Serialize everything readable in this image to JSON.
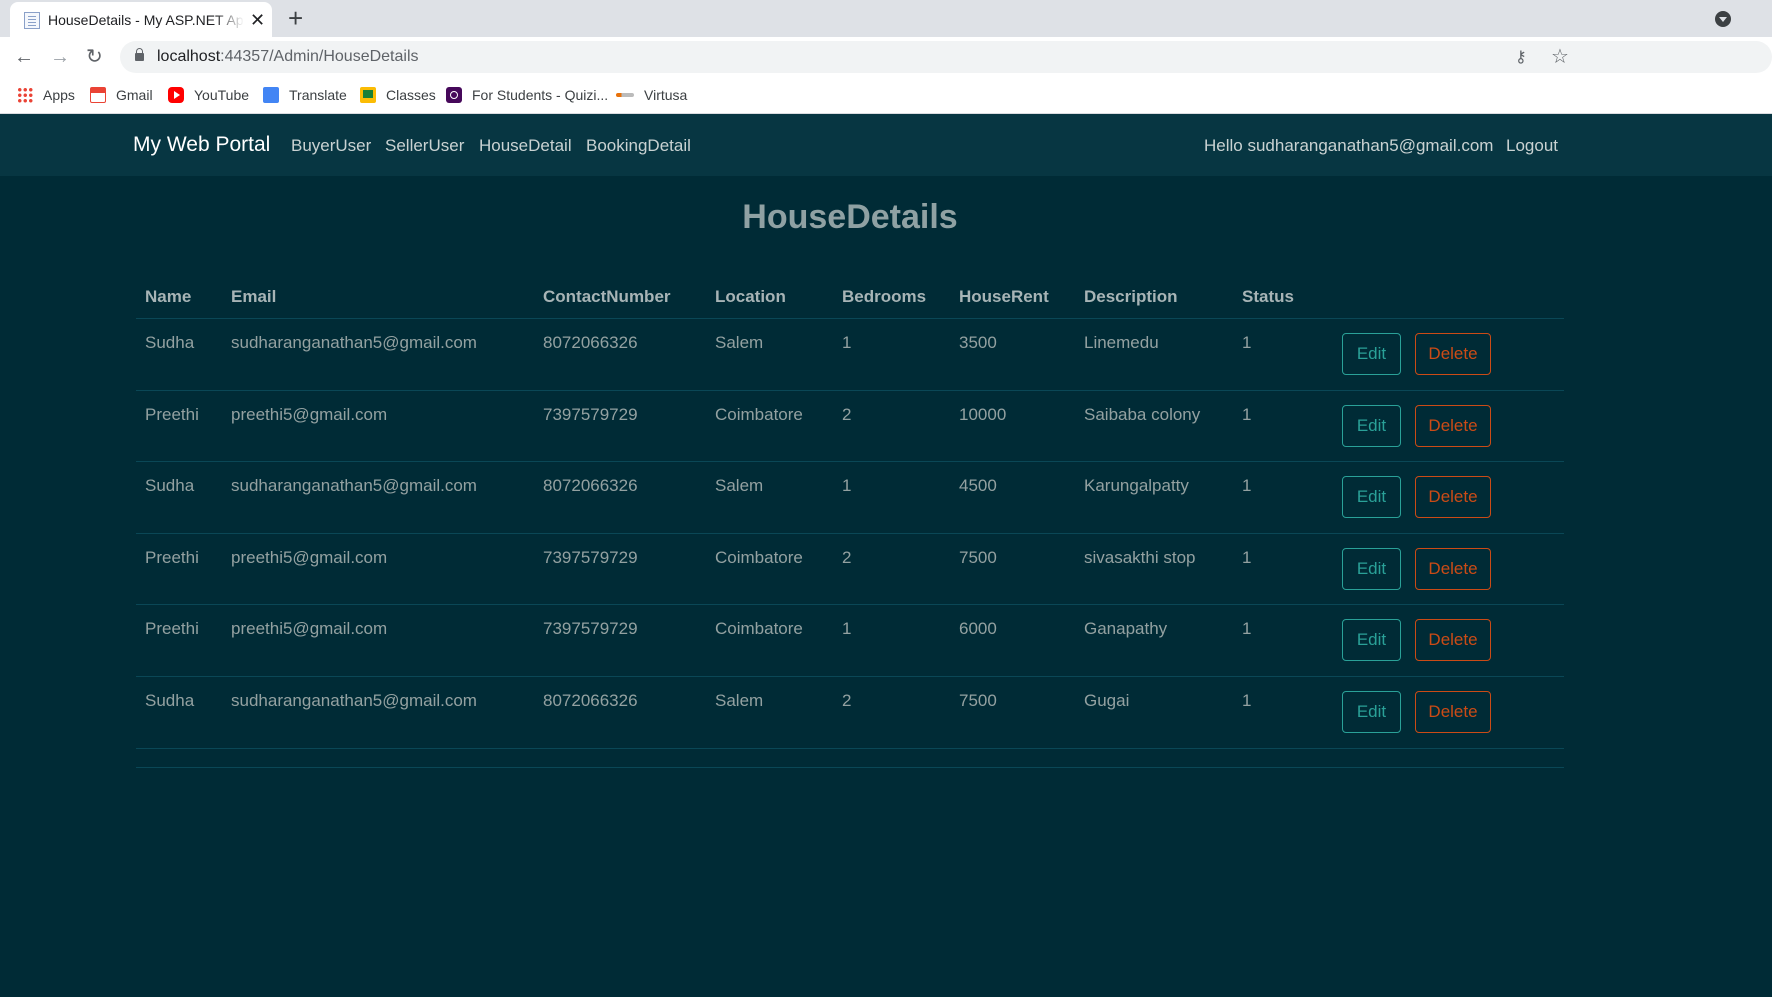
{
  "browser": {
    "tab_title": "HouseDetails - My ASP.NET Application",
    "url_host": "localhost",
    "url_rest": ":44357/Admin/HouseDetails",
    "bookmarks": [
      "Apps",
      "Gmail",
      "YouTube",
      "Translate",
      "Classes",
      "For Students - Quizi...",
      "Virtusa"
    ]
  },
  "navbar": {
    "brand": "My Web Portal",
    "links": [
      "BuyerUser",
      "SellerUser",
      "HouseDetail",
      "BookingDetail"
    ],
    "greeting": "Hello sudharanganathan5@gmail.com",
    "logout": "Logout"
  },
  "page": {
    "title": "HouseDetails"
  },
  "table": {
    "columns": [
      "Name",
      "Email",
      "ContactNumber",
      "Location",
      "Bedrooms",
      "HouseRent",
      "Description",
      "Status"
    ],
    "edit_label": "Edit",
    "delete_label": "Delete",
    "rows": [
      [
        "Sudha",
        "sudharanganathan5@gmail.com",
        "8072066326",
        "Salem",
        "1",
        "3500",
        "Linemedu",
        "1"
      ],
      [
        "Preethi",
        "preethi5@gmail.com",
        "7397579729",
        "Coimbatore",
        "2",
        "10000",
        "Saibaba colony",
        "1"
      ],
      [
        "Sudha",
        "sudharanganathan5@gmail.com",
        "8072066326",
        "Salem",
        "1",
        "4500",
        "Karungalpatty",
        "1"
      ],
      [
        "Preethi",
        "preethi5@gmail.com",
        "7397579729",
        "Coimbatore",
        "2",
        "7500",
        "sivasakthi stop",
        "1"
      ],
      [
        "Preethi",
        "preethi5@gmail.com",
        "7397579729",
        "Coimbatore",
        "1",
        "6000",
        "Ganapathy",
        "1"
      ],
      [
        "Sudha",
        "sudharanganathan5@gmail.com",
        "8072066326",
        "Salem",
        "2",
        "7500",
        "Gugai",
        "1"
      ]
    ]
  },
  "colors": {
    "page_bg": "#002b36",
    "navbar_bg": "#073642",
    "edit": "#2aa198",
    "delete": "#cb4b16"
  }
}
